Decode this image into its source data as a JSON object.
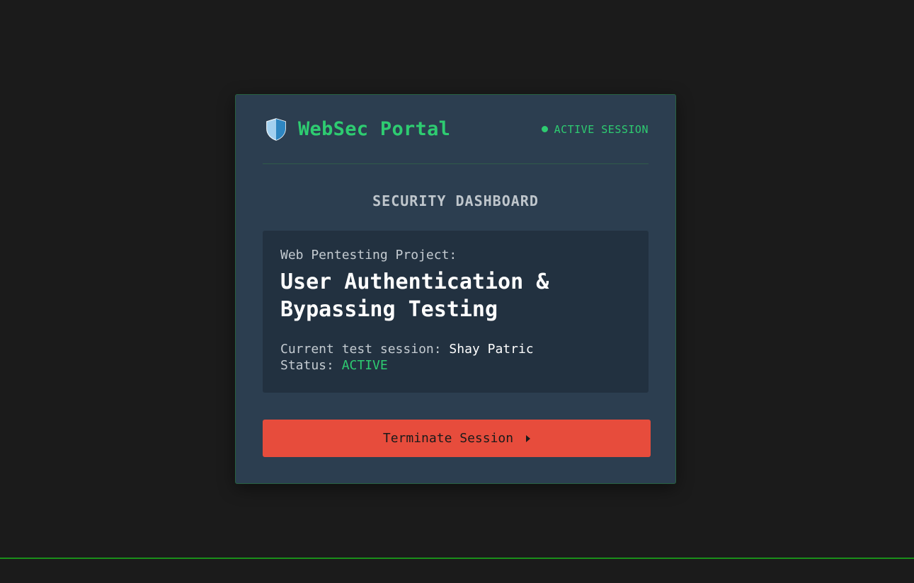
{
  "header": {
    "brand_title": "WebSec Portal",
    "brand_icon": "shield-icon",
    "session_status": "ACTIVE SESSION"
  },
  "dashboard": {
    "title": "SECURITY DASHBOARD",
    "project_label": "Web Pentesting Project:",
    "project_name": "User Authentication & Bypassing Testing",
    "session_label": "Current test session:",
    "session_user": "Shay Patric",
    "status_label": "Status:",
    "status_value": "ACTIVE"
  },
  "actions": {
    "terminate_label": "Terminate Session"
  },
  "colors": {
    "accent": "#2ecc71",
    "danger": "#e74c3c",
    "card_bg": "#2c3e50",
    "page_bg": "#1b1b1b"
  }
}
